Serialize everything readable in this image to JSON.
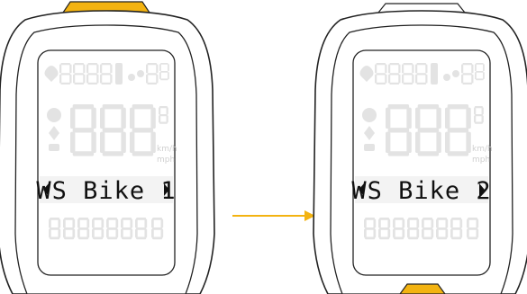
{
  "accent_color": "#f3b311",
  "arrow_color": "#f3b311",
  "devices": [
    {
      "id": "before",
      "label": "WS Bike 1",
      "highlighted_button": "top",
      "unit_top": "km/h",
      "unit_bottom": "mph"
    },
    {
      "id": "after",
      "label": "WS Bike 2",
      "highlighted_button": "bottom",
      "unit_top": "km/h",
      "unit_bottom": "mph"
    }
  ],
  "arrow": {
    "direction": "right"
  }
}
